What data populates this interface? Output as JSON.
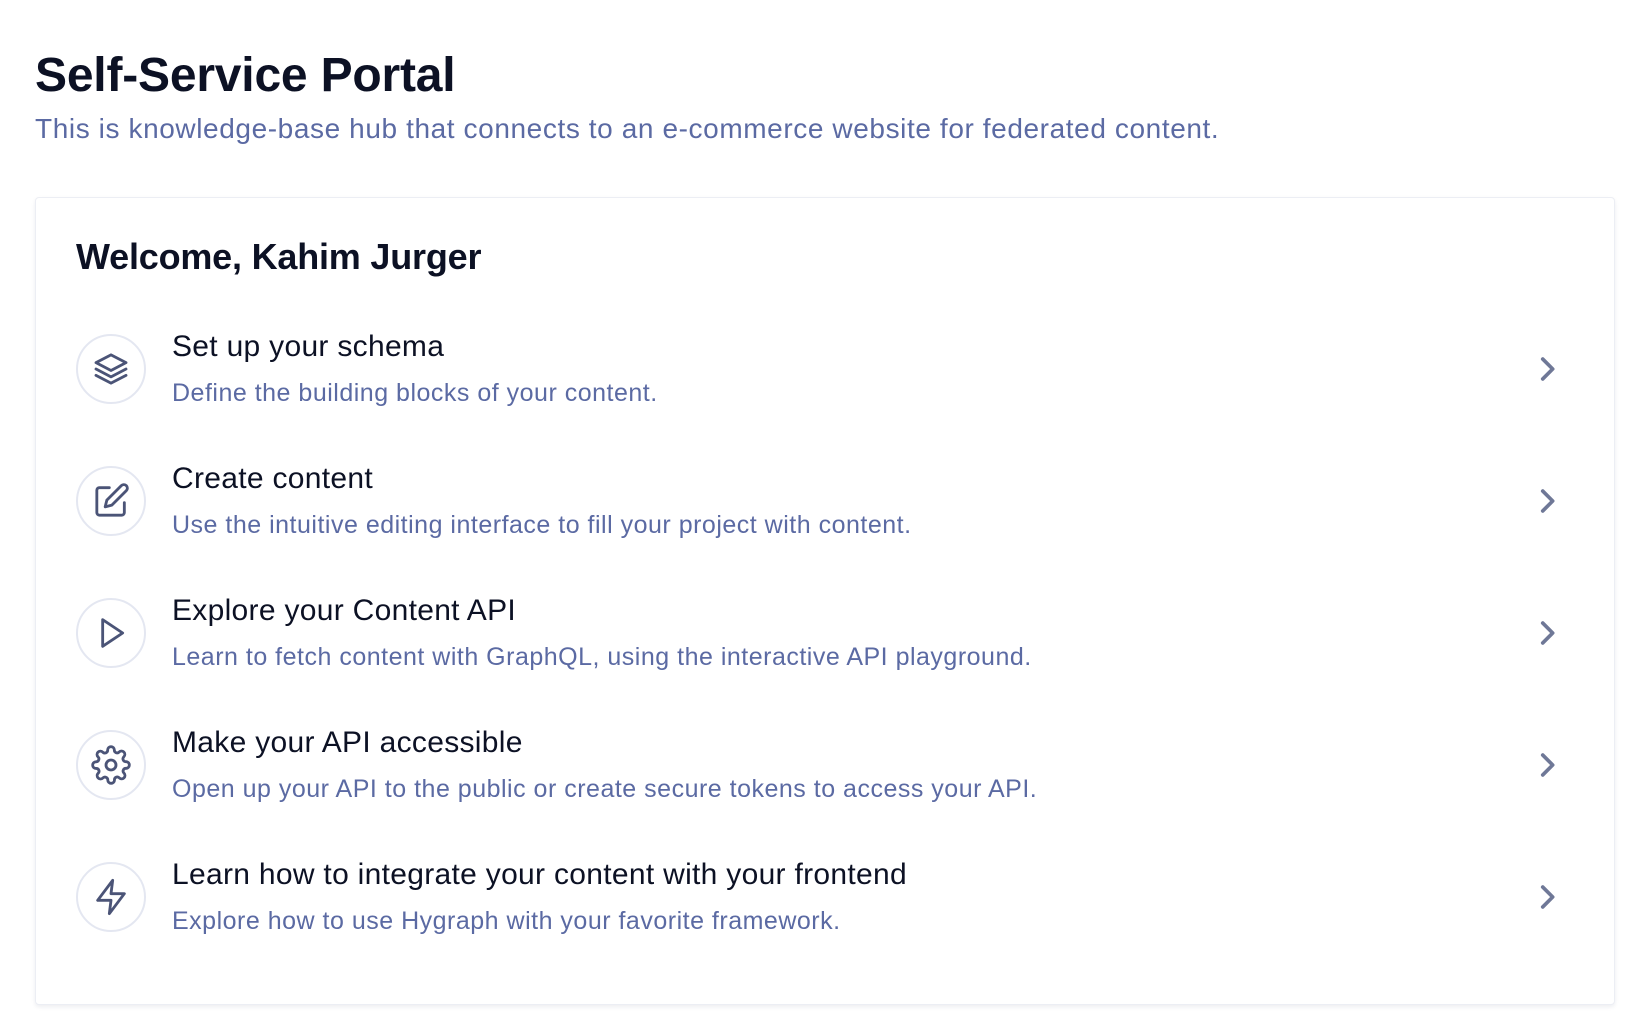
{
  "header": {
    "title": "Self-Service Portal",
    "subtitle": "This is knowledge-base hub that connects to an e-commerce website for federated content."
  },
  "card": {
    "welcome": "Welcome, Kahim Jurger",
    "steps": [
      {
        "icon": "layers-icon",
        "title": "Set up your schema",
        "description": "Define the building blocks of your content."
      },
      {
        "icon": "edit-icon",
        "title": "Create content",
        "description": "Use the intuitive editing interface to fill your project with content."
      },
      {
        "icon": "play-icon",
        "title": "Explore your Content API",
        "description": "Learn to fetch content with GraphQL, using the interactive API playground."
      },
      {
        "icon": "gear-icon",
        "title": "Make your API accessible",
        "description": "Open up your API to the public or create secure tokens to access your API."
      },
      {
        "icon": "lightning-icon",
        "title": "Learn how to integrate your content with your frontend",
        "description": "Explore how to use Hygraph with your favorite framework."
      }
    ]
  },
  "colors": {
    "heading": "#0c1124",
    "muted_text": "#5b6aa3",
    "icon_stroke": "#4b5477",
    "icon_border": "#e4e7f1",
    "chevron": "#6f7897",
    "card_border": "#eceef4"
  }
}
